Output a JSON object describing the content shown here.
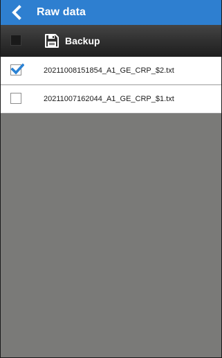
{
  "header": {
    "title": "Raw data",
    "background": "#2e7fd0"
  },
  "toolbar": {
    "backup_label": "Backup",
    "select_all_checked": false
  },
  "files": [
    {
      "name": "20211008151854_A1_GE_CRP_$2.txt",
      "checked": true
    },
    {
      "name": "20211007162044_A1_GE_CRP_$1.txt",
      "checked": false
    }
  ],
  "icons": {
    "back": "chevron-left-icon",
    "backup": "floppy-disk-icon",
    "check": "checkmark-icon"
  },
  "colors": {
    "check_mark": "#2a82d4",
    "empty_area": "#7a7a78"
  }
}
